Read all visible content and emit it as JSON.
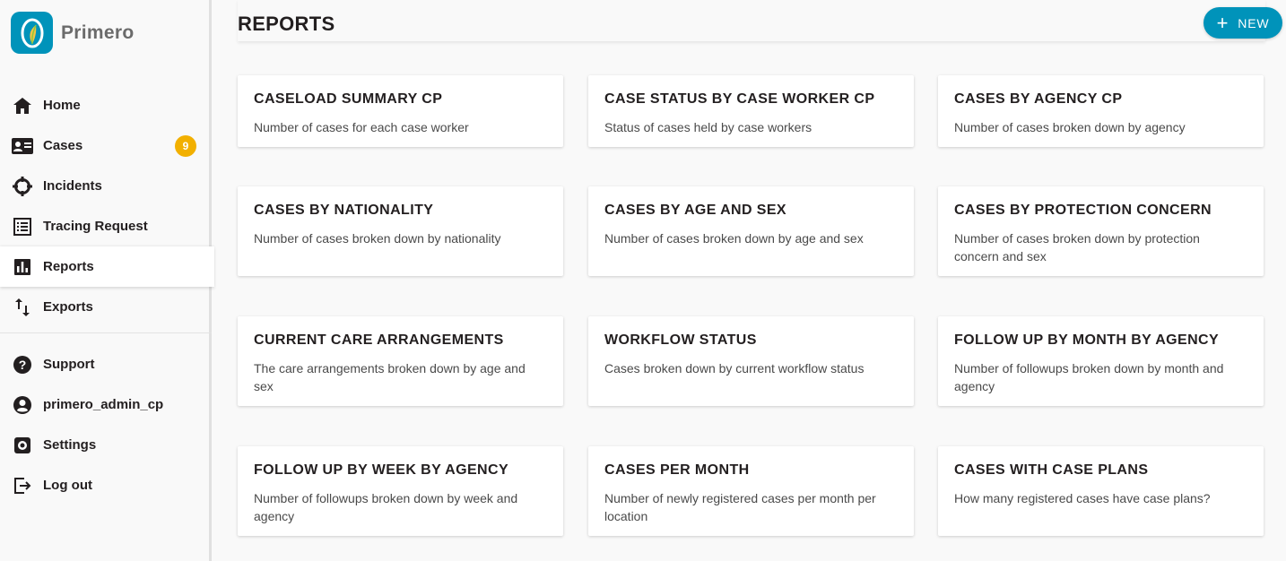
{
  "app": {
    "name": "Primero"
  },
  "nav": {
    "primary": [
      {
        "label": "Home",
        "icon": "home-icon"
      },
      {
        "label": "Cases",
        "icon": "cases-icon",
        "badge": "9"
      },
      {
        "label": "Incidents",
        "icon": "incidents-icon"
      },
      {
        "label": "Tracing Request",
        "icon": "tracing-request-icon"
      },
      {
        "label": "Reports",
        "icon": "reports-icon",
        "active": true
      },
      {
        "label": "Exports",
        "icon": "exports-icon"
      }
    ],
    "secondary": [
      {
        "label": "Support",
        "icon": "help-icon"
      },
      {
        "label": "primero_admin_cp",
        "icon": "account-icon"
      },
      {
        "label": "Settings",
        "icon": "settings-icon"
      },
      {
        "label": "Log out",
        "icon": "logout-icon"
      }
    ]
  },
  "header": {
    "title": "REPORTS",
    "new_label": "NEW"
  },
  "reports": [
    {
      "title": "CASELOAD SUMMARY CP",
      "description": "Number of cases for each case worker"
    },
    {
      "title": "CASE STATUS BY CASE WORKER CP",
      "description": "Status of cases held by case workers"
    },
    {
      "title": "CASES BY AGENCY CP",
      "description": "Number of cases broken down by agency"
    },
    {
      "title": "CASES BY NATIONALITY",
      "description": "Number of cases broken down by nationality"
    },
    {
      "title": "CASES BY AGE AND SEX",
      "description": "Number of cases broken down by age and sex"
    },
    {
      "title": "CASES BY PROTECTION CONCERN",
      "description": "Number of cases broken down by protection concern and sex"
    },
    {
      "title": "CURRENT CARE ARRANGEMENTS",
      "description": "The care arrangements broken down by age and sex"
    },
    {
      "title": "WORKFLOW STATUS",
      "description": "Cases broken down by current workflow status"
    },
    {
      "title": "FOLLOW UP BY MONTH BY AGENCY",
      "description": "Number of followups broken down by month and agency"
    },
    {
      "title": "FOLLOW UP BY WEEK BY AGENCY",
      "description": "Number of followups broken down by week and agency"
    },
    {
      "title": "CASES PER MONTH",
      "description": "Number of newly registered cases per month per location"
    },
    {
      "title": "CASES WITH CASE PLANS",
      "description": "How many registered cases have case plans?"
    }
  ],
  "colors": {
    "accent": "#0093ba",
    "badge": "#f2b000",
    "text": "#231f20"
  }
}
